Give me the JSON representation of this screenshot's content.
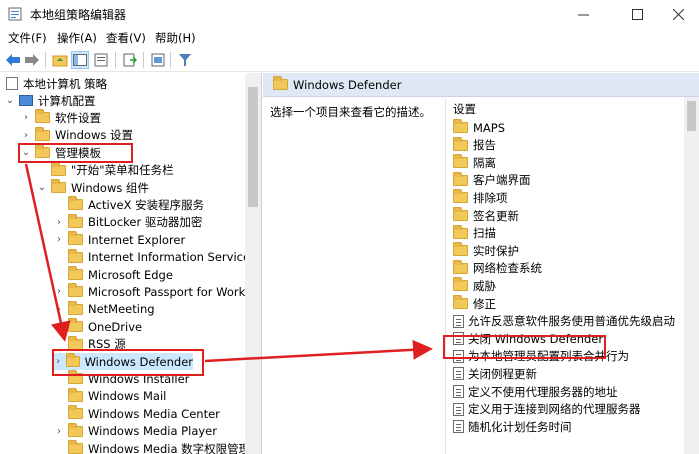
{
  "window": {
    "title": "本地组策略编辑器"
  },
  "menu": [
    "文件(F)",
    "操作(A)",
    "查看(V)",
    "帮助(H)"
  ],
  "tree": {
    "root": "本地计算机 策略",
    "items": [
      {
        "label": "计算机配置",
        "level": 1,
        "expand": "open",
        "icon": "pc-icon"
      },
      {
        "label": "软件设置",
        "level": 2,
        "expand": "closed",
        "icon": "folder-icon"
      },
      {
        "label": "Windows 设置",
        "level": 2,
        "expand": "closed",
        "icon": "folder-icon"
      },
      {
        "label": "管理模板",
        "level": 2,
        "expand": "open",
        "icon": "folder-icon"
      },
      {
        "label": "\"开始\"菜单和任务栏",
        "level": 3,
        "expand": "none",
        "icon": "folder-icon"
      },
      {
        "label": "Windows 组件",
        "level": 3,
        "expand": "open",
        "icon": "folder-icon"
      },
      {
        "label": "ActiveX 安装程序服务",
        "level": 4,
        "expand": "none",
        "icon": "folder-icon"
      },
      {
        "label": "BitLocker 驱动器加密",
        "level": 4,
        "expand": "closed",
        "icon": "folder-icon"
      },
      {
        "label": "Internet Explorer",
        "level": 4,
        "expand": "closed",
        "icon": "folder-icon"
      },
      {
        "label": "Internet Information Services",
        "level": 4,
        "expand": "none",
        "icon": "folder-icon"
      },
      {
        "label": "Microsoft Edge",
        "level": 4,
        "expand": "none",
        "icon": "folder-icon"
      },
      {
        "label": "Microsoft Passport for Work",
        "level": 4,
        "expand": "closed",
        "icon": "folder-icon"
      },
      {
        "label": "NetMeeting",
        "level": 4,
        "expand": "closed",
        "icon": "folder-icon"
      },
      {
        "label": "OneDrive",
        "level": 4,
        "expand": "none",
        "icon": "folder-icon"
      },
      {
        "label": "RSS 源",
        "level": 4,
        "expand": "none",
        "icon": "folder-icon"
      },
      {
        "label": "Windows Defender",
        "level": 4,
        "expand": "closed",
        "icon": "folder-icon"
      },
      {
        "label": "Windows Installer",
        "level": 4,
        "expand": "none",
        "icon": "folder-icon"
      },
      {
        "label": "Windows Mail",
        "level": 4,
        "expand": "none",
        "icon": "folder-icon"
      },
      {
        "label": "Windows Media Center",
        "level": 4,
        "expand": "none",
        "icon": "folder-icon"
      },
      {
        "label": "Windows Media Player",
        "level": 4,
        "expand": "closed",
        "icon": "folder-icon"
      },
      {
        "label": "Windows Media 数字权限管理",
        "level": 4,
        "expand": "none",
        "icon": "folder-icon"
      }
    ]
  },
  "right": {
    "header": "Windows Defender",
    "description": "选择一个项目来查看它的描述。",
    "column_header": "设置",
    "items": [
      {
        "label": "MAPS",
        "icon": "folder-icon"
      },
      {
        "label": "报告",
        "icon": "folder-icon"
      },
      {
        "label": "隔离",
        "icon": "folder-icon"
      },
      {
        "label": "客户端界面",
        "icon": "folder-icon"
      },
      {
        "label": "排除项",
        "icon": "folder-icon"
      },
      {
        "label": "签名更新",
        "icon": "folder-icon"
      },
      {
        "label": "扫描",
        "icon": "folder-icon"
      },
      {
        "label": "实时保护",
        "icon": "folder-icon"
      },
      {
        "label": "网络检查系统",
        "icon": "folder-icon"
      },
      {
        "label": "威胁",
        "icon": "folder-icon"
      },
      {
        "label": "修正",
        "icon": "folder-icon"
      },
      {
        "label": "允许反恶意软件服务使用普通优先级启动",
        "icon": "setting-icon"
      },
      {
        "label": "关闭 Windows Defender",
        "icon": "setting-icon"
      },
      {
        "label": "为本地管理员配置列表合并行为",
        "icon": "setting-icon"
      },
      {
        "label": "关闭例程更新",
        "icon": "setting-icon"
      },
      {
        "label": "定义不使用代理服务器的地址",
        "icon": "setting-icon"
      },
      {
        "label": "定义用于连接到网络的代理服务器",
        "icon": "setting-icon"
      },
      {
        "label": "随机化计划任务时间",
        "icon": "setting-icon"
      }
    ]
  },
  "colors": {
    "highlight": "#e02020",
    "selection": "#cce8ff",
    "header_bg": "#dfe9f5"
  }
}
